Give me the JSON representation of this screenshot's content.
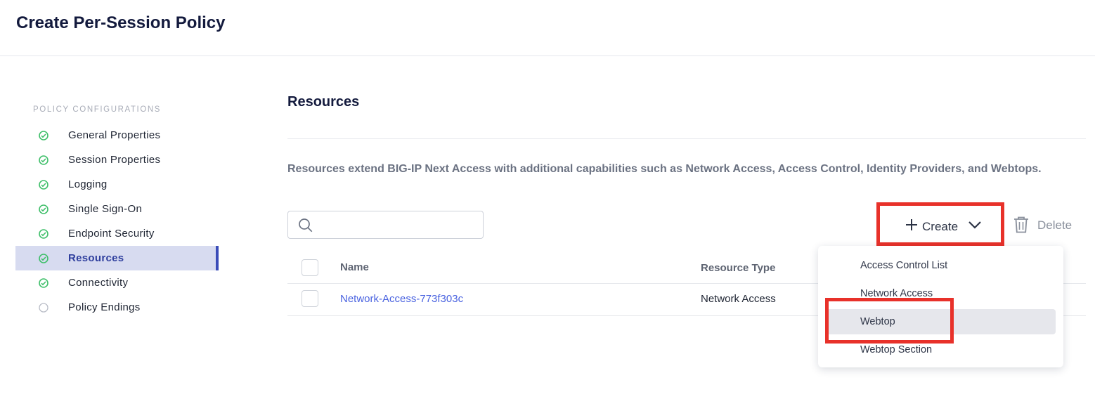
{
  "page": {
    "title": "Create Per-Session Policy"
  },
  "sidebar": {
    "section_label": "POLICY CONFIGURATIONS",
    "items": [
      {
        "label": "General Properties",
        "status": "complete"
      },
      {
        "label": "Session Properties",
        "status": "complete"
      },
      {
        "label": "Logging",
        "status": "complete"
      },
      {
        "label": "Single Sign-On",
        "status": "complete"
      },
      {
        "label": "Endpoint Security",
        "status": "complete"
      },
      {
        "label": "Resources",
        "status": "complete",
        "active": true
      },
      {
        "label": "Connectivity",
        "status": "complete"
      },
      {
        "label": "Policy Endings",
        "status": "incomplete"
      }
    ]
  },
  "main": {
    "title": "Resources",
    "description": "Resources extend BIG-IP Next Access with additional capabilities such as Network Access, Access Control, Identity Providers, and Webtops.",
    "search": {
      "value": "",
      "placeholder": ""
    },
    "toolbar": {
      "create_label": "Create",
      "delete_label": "Delete"
    },
    "table": {
      "columns": [
        "Name",
        "Resource Type"
      ],
      "rows": [
        {
          "name": "Network-Access-773f303c",
          "type": "Network Access"
        }
      ]
    },
    "create_menu": {
      "items": [
        "Access Control List",
        "Network Access",
        "Webtop",
        "Webtop Section"
      ],
      "highlighted": "Webtop"
    }
  },
  "colors": {
    "accent": "#3b4cb8",
    "active_bg": "#d7dbf0",
    "check_green": "#3fbf6a",
    "link": "#4a63e0",
    "annotation_red": "#e8312a"
  }
}
